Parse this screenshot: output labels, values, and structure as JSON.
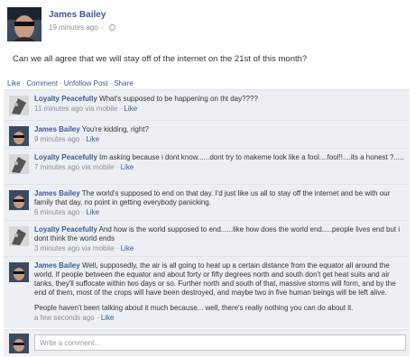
{
  "post": {
    "author": "James Bailey",
    "time": "19 minutes ago",
    "text": "Can we all agree that we will stay off of the internet on the 21st of this month?",
    "actions": [
      "Like",
      "Comment",
      "Unfollow Post",
      "Share"
    ]
  },
  "comments": [
    {
      "author": "Loyalty Peacefully",
      "text": "What's supposed to be happening on tht day????",
      "time": "11 minutes ago via mobile",
      "like": "Like",
      "avatar": "grey-portrait"
    },
    {
      "author": "James Bailey",
      "text": "You're kidding, right?",
      "time": "9 minutes ago",
      "like": "Like",
      "avatar": "james-portrait"
    },
    {
      "author": "Loyalty Peacefully",
      "text": "Im asking because i dont know......dont try to makeme look like a fool....fool!!....its a honest ?.....",
      "time": "7 minutes ago via mobile",
      "like": "Like",
      "avatar": "grey-portrait"
    },
    {
      "author": "James Bailey",
      "text": "The world's supposed to end on that day. I'd just like us all to stay off the internet and be with our family that day, no point in getting everybody panicking.",
      "time": "6 minutes ago",
      "like": "Like",
      "avatar": "james-portrait"
    },
    {
      "author": "Loyalty Peacefully",
      "text": "And how is the world supposed to end......like how does the world end.....people lives end but i dont think the world ends",
      "time": "3 minutes ago via mobile",
      "like": "Like",
      "avatar": "grey-portrait"
    },
    {
      "author": "James Bailey",
      "text": "Well, supposedly, the air is all going to heat up a certain distance from the equator all around the world. If people between the equator and about forty or fifty degrees north and south don't get heat suits and air tanks, they'll suffocate within two days or so. Further north and south of that, massive storms will form, and by the end of them, most of the crops will have been destroyed, and maybe two in five human beings will be left alive.",
      "text2": "People haven't been talking about it much because... well, there's really nothing you can do about it.",
      "time": "a few seconds ago",
      "like": "Like",
      "avatar": "james-portrait"
    }
  ],
  "compose": {
    "placeholder": "Write a comment..."
  },
  "colors": {
    "link": "#3b5998",
    "comment_bg": "#edeff4",
    "meta": "#8a8f97"
  }
}
